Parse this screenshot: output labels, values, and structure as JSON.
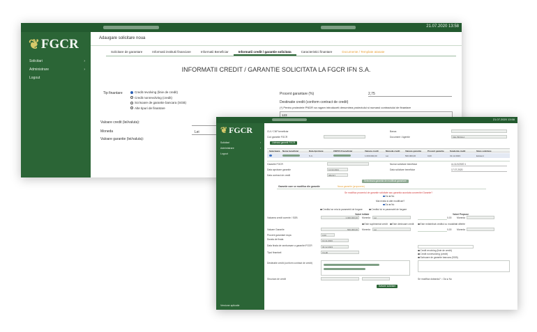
{
  "app": {
    "logo": "FGCR",
    "sidebar_items": [
      {
        "label": "Solicitari",
        "chevron": "›"
      },
      {
        "label": "Administrare",
        "chevron": "›"
      },
      {
        "label": "Logout",
        "chevron": ""
      }
    ]
  },
  "window1": {
    "topbar_datetime": "21.07.2020 13:58",
    "page_title": "Adaugare solicitare noua",
    "tabs": [
      {
        "label": "Solicitare de garantare",
        "state": "normal"
      },
      {
        "label": "Informatii institutii financiare",
        "state": "normal"
      },
      {
        "label": "Informatii Beneficiar",
        "state": "normal"
      },
      {
        "label": "Informatii credit / garantie solicitata",
        "state": "active"
      },
      {
        "label": "Caracteristici finantare",
        "state": "normal"
      },
      {
        "label": "Documente / Template atasate",
        "state": "orange"
      }
    ],
    "heading": "INFORMATII CREDIT / GARANTIE SOLICITATA LA FGCR IFN S.A.",
    "tip_finantare_label": "Tip finantare",
    "tip_finantare_options": [
      {
        "label": "Credit revolving (linie de credit)",
        "selected": true
      },
      {
        "label": "Credit nonrevolving (credit)",
        "selected": false
      },
      {
        "label": "Scrisoare de garantie bancara (SGB)",
        "selected": false
      },
      {
        "label": "Alte tipuri de finantare",
        "selected": false
      }
    ],
    "procent_label": "Procent garantare (%)",
    "procent_value": "2,75",
    "destinatie_label": "Destinatie credit (conform contract de credit)",
    "destinatie_note": "(*) Pentru proiectele PNDR va rugam introduceti denumirea proiectului si numarul contractului de finantare",
    "destinatie_value": "123",
    "valoare_credit_label": "Valoare credit (lei/valuta):",
    "valoare_credit_value": "12,00",
    "moneda_label": "Moneda",
    "moneda_value": "Lei",
    "valoare_garantie_label": "Valoare garantie (lei/valuta):"
  },
  "window2": {
    "topbar_datetime": "21.07.2020 13:58",
    "sidebar_footer": "Versiune aplicatie",
    "labels": {
      "cui": "CUI / CNP beneficiar",
      "cod_garantie": "Cod garantie FGCR",
      "banca": "Banca",
      "document": "Document / Agentie",
      "adauga": "Listeaza garantii FGCR",
      "garantie_fgcr": "Garantie FGCR",
      "data_aprobare": "Data aprobare garantie",
      "data_contract": "Data contract de credit",
      "numar_solicitare": "Numar solicitare beneficiar",
      "data_solicitare": "Data solicitare beneficiar",
      "btn_aplica": "Selecteaza garantia de modificat garantare",
      "tab1": "Garantie care se modifica din garantie",
      "tab2": "Noua garantie (propunere)",
      "intrebare": "Se modifica procentul de garantie solicitate sau garantia acordata conventiei Garante?",
      "da": "Da",
      "nu": "Nu",
      "intrebare2": "Mai exista si alte modificari?",
      "da2": "Da",
      "nu2": "Nu",
      "check1": "Creditul se reia la parametrii de forgare",
      "check2": "Creditul isi re paramatrii de forgare",
      "col_valori_initiale": "Valori initiale",
      "col_valori_propuse": "Valori Propuse",
      "valoarea_credit": "Valoarea credit curente / SGB",
      "valoarea_credit_val": "1.000.000,00",
      "moneda": "Moneda",
      "moneda_val": "Lei",
      "procent_val": "0,00",
      "valoare_modificare": "Valoare Garantie",
      "valoare_garantie_val": "500.000,00",
      "moneda_val2": "Lei",
      "procent_val2": "0,00",
      "opt1": "Este suplimentat credit",
      "opt2": "Este diminuare credit",
      "opt3": "Este redistribuit creditul cu modalitati diferite",
      "procent_garantie": "Procent garantare dupa",
      "procent_garantie_val": "0,00",
      "durata_finala": "Durata de finala",
      "durata_finala_val": "13.11.2023",
      "data_scadenta": "Data finala de rambursare a garantiei FGCR",
      "data_scadenta_val": "30.12.2023",
      "tip_finantare": "Tipul finantarii",
      "tip_finantare_val": "Credit",
      "tip_opt1": "Credit revolving (linie de credit)",
      "tip_opt2": "Credit nonrevolving (credit)",
      "tip_opt3": "Scrisoare de garantie bancara (SGB)",
      "destinatie": "Destinatie credit (conform contract de credit)",
      "structura": "Structura de credit",
      "se_modifica": "Se modifica dobanda? ○ Da ● Nu",
      "btn_salveaza": "Salvare solicitare"
    },
    "table_headers": [
      "Selecteaza",
      "Nume beneficiar",
      "Data Aprobare",
      "CNP/CUI beneficiar",
      "Valoare credit",
      "Moneda credit",
      "Valoare garantie",
      "Procent garantie",
      "Scadenta credit",
      "Stare solicitare"
    ],
    "table_row": [
      "",
      "S.C.",
      "",
      "1.000.000,00",
      "Lei",
      "500.000,00",
      "0,00",
      "31.12.2023",
      "Existent"
    ],
    "fields": {
      "data_aprobare_val": "12.02.2021",
      "data_contract_val": "08/2/27",
      "numar_solicitare_val": "nr-11/1/2020 1",
      "data_solicitare_val": "17.07.2020",
      "banca_val": "",
      "document_val": "CEL BRAILA"
    }
  }
}
